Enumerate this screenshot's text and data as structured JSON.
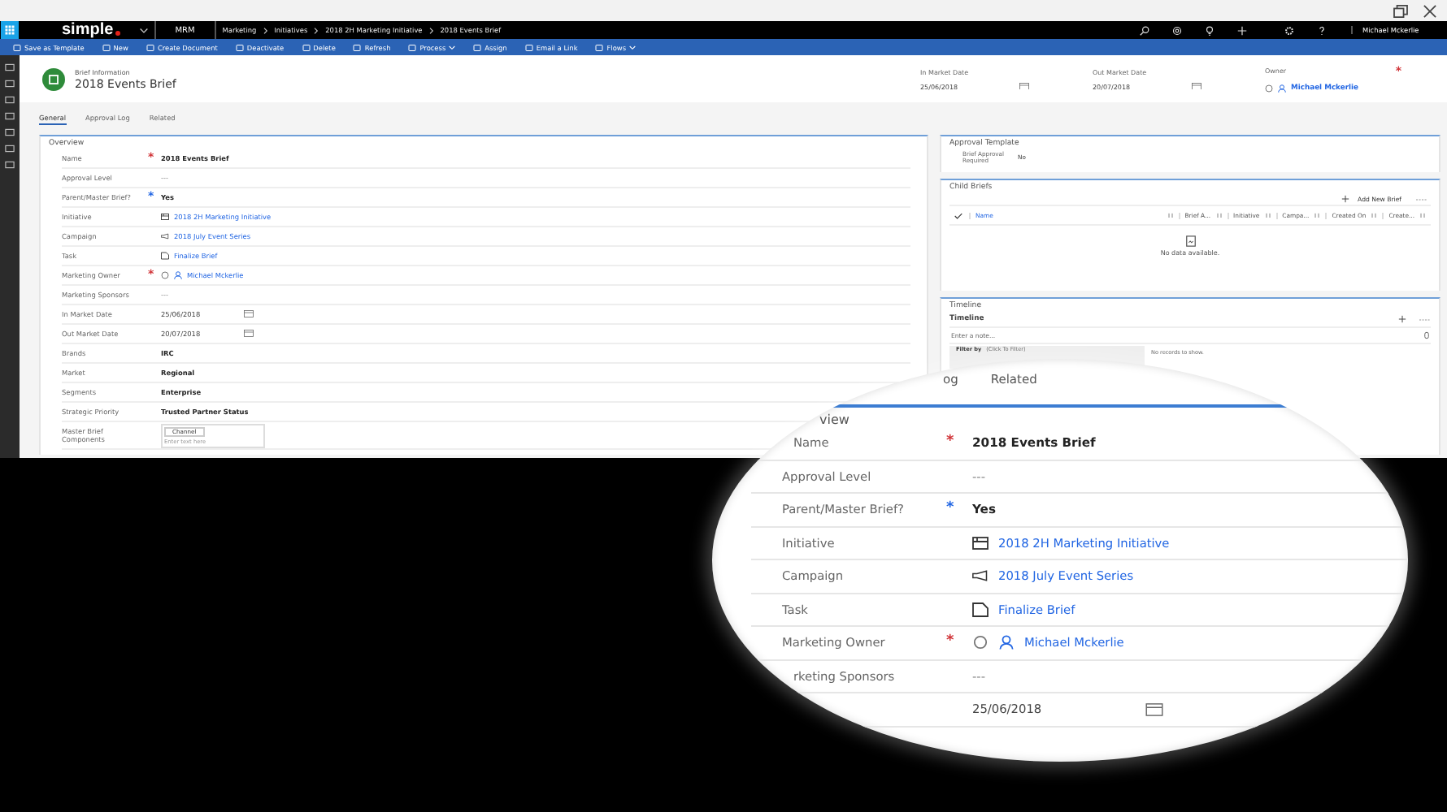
{
  "app_bar": {
    "logo": "simple",
    "app_name": "MRM",
    "breadcrumbs": [
      "Marketing",
      "Initiatives",
      "2018 2H Marketing Initiative",
      "2018 Events Brief"
    ],
    "user": "Michael Mckerlie"
  },
  "commands": [
    {
      "label": "Save as Template",
      "has_menu": false
    },
    {
      "label": "New",
      "has_menu": false
    },
    {
      "label": "Create Document",
      "has_menu": false
    },
    {
      "label": "Deactivate",
      "has_menu": false
    },
    {
      "label": "Delete",
      "has_menu": false
    },
    {
      "label": "Refresh",
      "has_menu": false
    },
    {
      "label": "Process",
      "has_menu": true
    },
    {
      "label": "Assign",
      "has_menu": false
    },
    {
      "label": "Email a Link",
      "has_menu": false
    },
    {
      "label": "Flows",
      "has_menu": true
    }
  ],
  "header": {
    "form_selector": "Brief Information",
    "title": "2018 Events Brief",
    "fields": [
      {
        "label": "In Market Date",
        "value": "25/06/2018",
        "kind": "date"
      },
      {
        "label": "Out Market Date",
        "value": "20/07/2018",
        "kind": "date"
      },
      {
        "label": "Owner",
        "value": "Michael Mckerlie",
        "kind": "owner",
        "marker": "*",
        "color": "#d13438"
      }
    ]
  },
  "tabs": [
    {
      "label": "General",
      "selected": true
    },
    {
      "label": "Approval Log",
      "selected": false
    },
    {
      "label": "Related",
      "selected": false
    }
  ],
  "overview": {
    "title": "Overview",
    "rows": [
      {
        "label": "Name",
        "marker": "*",
        "color": "#d13438",
        "value": "2018 Events Brief",
        "kind": "bold"
      },
      {
        "label": "Approval Level",
        "value": "---",
        "kind": "empty"
      },
      {
        "label": "Parent/Master Brief?",
        "marker": "*",
        "color": "#2266e3",
        "value": "Yes",
        "kind": "bold"
      },
      {
        "label": "Initiative",
        "value": "2018 2H Marketing Initiative",
        "kind": "initiative"
      },
      {
        "label": "Campaign",
        "value": "2018 July Event Series",
        "kind": "campaign"
      },
      {
        "label": "Task",
        "value": "Finalize Brief",
        "kind": "task"
      },
      {
        "label": "Marketing Owner",
        "marker": "*",
        "color": "#d13438",
        "value": "Michael Mckerlie",
        "kind": "owner"
      },
      {
        "label": "Marketing Sponsors",
        "value": "---",
        "kind": "empty"
      },
      {
        "label": "In Market Date",
        "value": "25/06/2018",
        "kind": "date"
      },
      {
        "label": "Out Market Date",
        "value": "20/07/2018",
        "kind": "date"
      },
      {
        "label": "Brands",
        "value": "IRC",
        "kind": "bold"
      },
      {
        "label": "Market",
        "value": "Regional",
        "kind": "bold"
      },
      {
        "label": "Segments",
        "value": "Enterprise",
        "kind": "bold"
      },
      {
        "label": "Strategic Priority",
        "value": "Trusted Partner Status",
        "kind": "bold"
      },
      {
        "label": "Master Brief Components",
        "kind": "tags",
        "tags": [
          "Channel"
        ],
        "placeholder": "Enter text here"
      }
    ]
  },
  "approval_template": {
    "title": "Approval Template",
    "rows": [
      {
        "label": "Brief Approval Required",
        "value": "No"
      }
    ]
  },
  "child_briefs": {
    "title": "Child Briefs",
    "add_label": "Add New Brief",
    "columns": [
      "Name",
      "Brief A...",
      "Initiative",
      "Campa...",
      "Created On",
      "Create..."
    ],
    "empty_message": "No data available."
  },
  "timeline": {
    "title": "Timeline",
    "subtitle": "Timeline",
    "note_placeholder": "Enter a note...",
    "filter_label": "Filter by",
    "filter_value": "(Click To Filter)",
    "empty_message": "No records to show."
  },
  "magnifier": {
    "tabs": [
      "og",
      "Related"
    ],
    "heading": "view",
    "rows": [
      {
        "label": "Name",
        "marker": "*",
        "color": "#d13438",
        "value": "2018 Events Brief",
        "kind": "bold"
      },
      {
        "label": "Approval Level",
        "value": "---",
        "kind": "empty"
      },
      {
        "label": "Parent/Master Brief?",
        "marker": "*",
        "color": "#2266e3",
        "value": "Yes",
        "kind": "bold"
      },
      {
        "label": "Initiative",
        "value": "2018 2H Marketing Initiative",
        "kind": "initiative"
      },
      {
        "label": "Campaign",
        "value": "2018 July Event Series",
        "kind": "campaign"
      },
      {
        "label": "Task",
        "value": "Finalize Brief",
        "kind": "task"
      },
      {
        "label": "Marketing Owner",
        "marker": "*",
        "color": "#d13438",
        "value": "Michael Mckerlie",
        "kind": "owner"
      },
      {
        "label": "rketing Sponsors",
        "value": "---",
        "kind": "empty"
      },
      {
        "value": "25/06/2018",
        "kind": "date"
      }
    ]
  }
}
